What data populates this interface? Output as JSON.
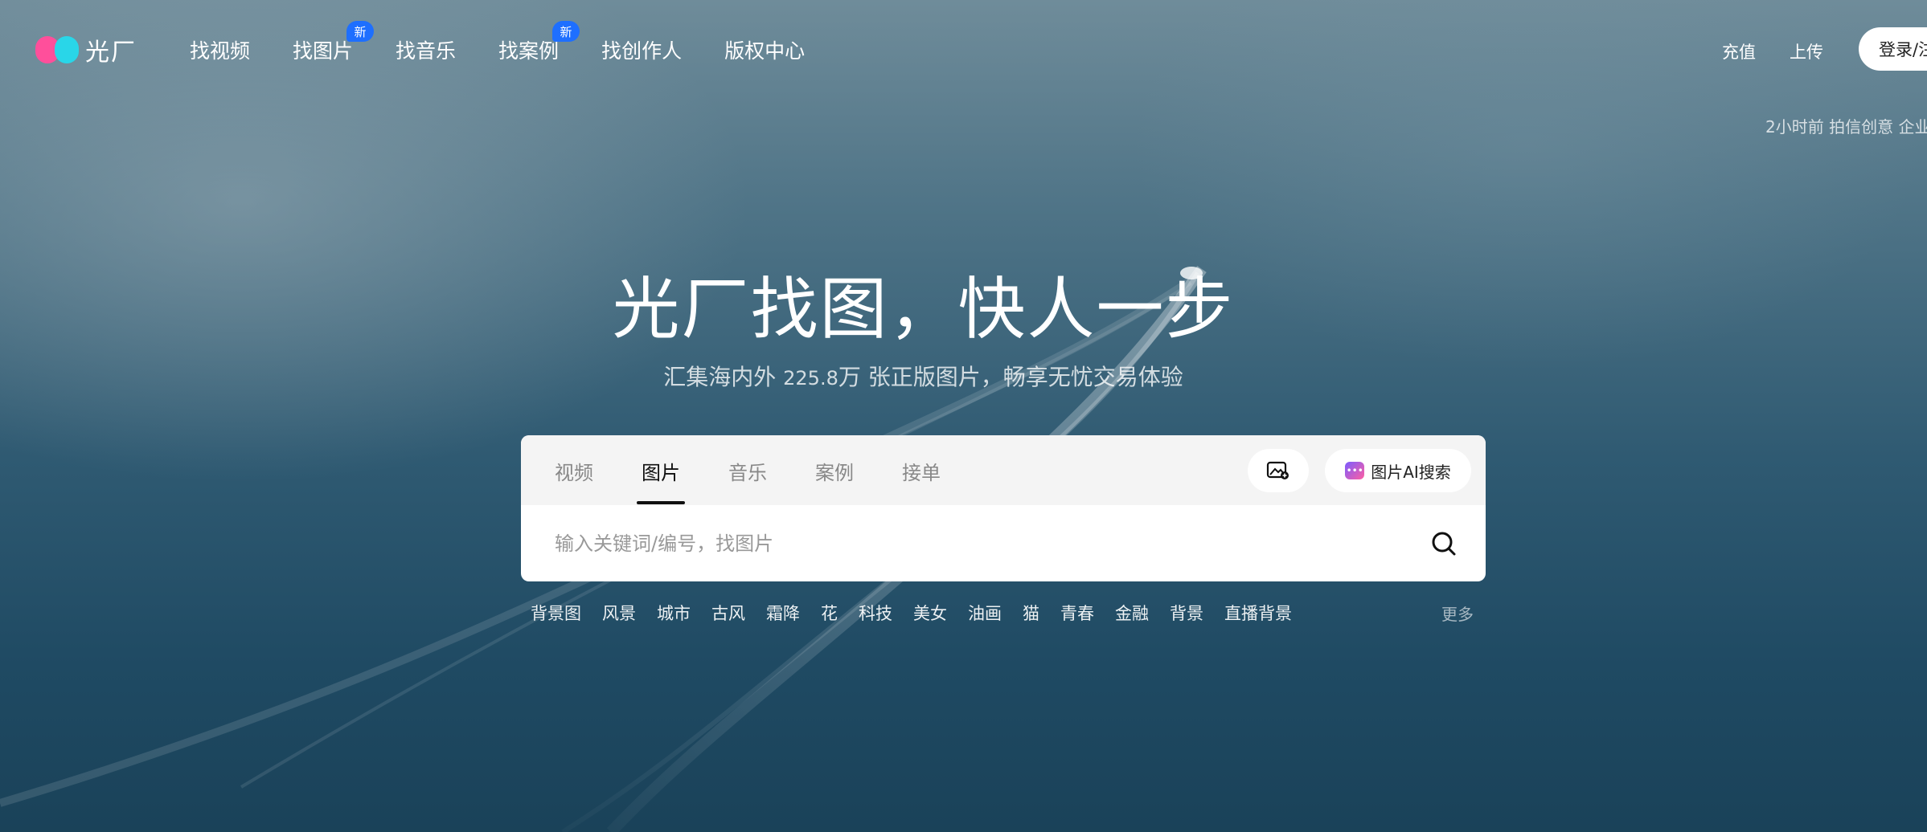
{
  "brand": {
    "name": "光厂"
  },
  "nav": {
    "items": [
      {
        "label": "找视频"
      },
      {
        "label": "找图片",
        "badge": "新"
      },
      {
        "label": "找音乐"
      },
      {
        "label": "找案例",
        "badge": "新"
      },
      {
        "label": "找创作人"
      },
      {
        "label": "版权中心"
      }
    ]
  },
  "header_right": {
    "recharge": "充值",
    "upload": "上传",
    "login": "登录/注"
  },
  "ticker": "2小时前 拍信创意 企业",
  "hero": {
    "title": "光厂找图，快人一步",
    "subtitle_prefix": "汇集海内外 ",
    "subtitle_count": "225.8",
    "subtitle_suffix": "万 张正版图片，畅享无忧交易体验"
  },
  "search": {
    "tabs": [
      {
        "label": "视频"
      },
      {
        "label": "图片",
        "active": true
      },
      {
        "label": "音乐"
      },
      {
        "label": "案例"
      },
      {
        "label": "接单"
      }
    ],
    "image_search_icon": "image-search-icon",
    "ai_search_label": "图片AI搜索",
    "placeholder": "输入关键词/编号，找图片",
    "value": ""
  },
  "tags": {
    "items": [
      "背景图",
      "风景",
      "城市",
      "古风",
      "霜降",
      "花",
      "科技",
      "美女",
      "油画",
      "猫",
      "青春",
      "金融",
      "背景",
      "直播背景"
    ],
    "more": "更多"
  },
  "colors": {
    "badge": "#1e6fff",
    "logo_pink": "#ff4f9b",
    "logo_cyan": "#29d6e8"
  }
}
